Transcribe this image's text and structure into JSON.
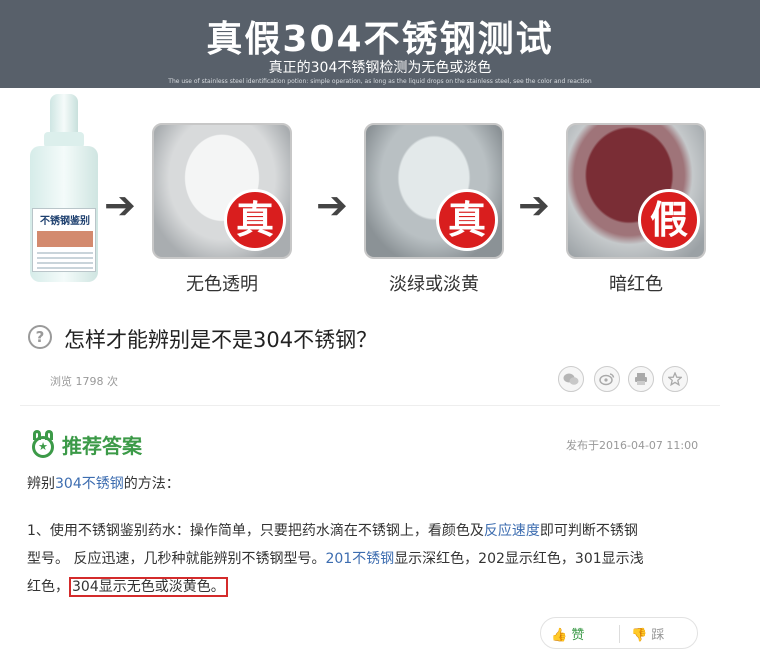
{
  "banner": {
    "title": "真假304不锈钢测试",
    "subtitle": "真正的304不锈钢检测为无色或淡色",
    "tiny": "The use of stainless steel identification potion: simple operation, as long as the liquid drops on the stainless steel, see the color and reaction"
  },
  "figure": {
    "bottle_label": "不锈钢鉴别",
    "steps": [
      {
        "stamp": "真",
        "caption": "无色透明"
      },
      {
        "stamp": "真",
        "caption": "淡绿或淡黄"
      },
      {
        "stamp": "假",
        "caption": "暗红色"
      }
    ],
    "arrow": "➔"
  },
  "question": {
    "icon": "?",
    "text": "怎样才能辨别是不是304不锈钢？",
    "views": "浏览 1798 次"
  },
  "share_icons": [
    "wechat-icon",
    "weibo-icon",
    "print-icon",
    "star-icon"
  ],
  "answer": {
    "title": "推荐答案",
    "date": "发布于2016-04-07 11:00",
    "intro_prefix": "辨别",
    "intro_link": "304不锈钢",
    "intro_suffix": "的方法：",
    "p1_a": "1、使用不锈钢鉴别药水：操作简单，只要把药水滴在不锈钢上，看颜色及",
    "p1_link": "反应速度",
    "p1_b": "即可判断不锈钢",
    "p2_a": "型号。 反应迅速，几秒种就能辨别不锈钢型号。",
    "p2_link": "201不锈钢",
    "p2_b": "显示深红色，202显示红色，301显示浅",
    "p3_a": "红色，",
    "p3_boxed": "304显示无色或淡黄色。"
  },
  "votes": {
    "up_label": "赞",
    "down_label": "踩",
    "up_icon": "👍",
    "down_icon": "👎"
  }
}
